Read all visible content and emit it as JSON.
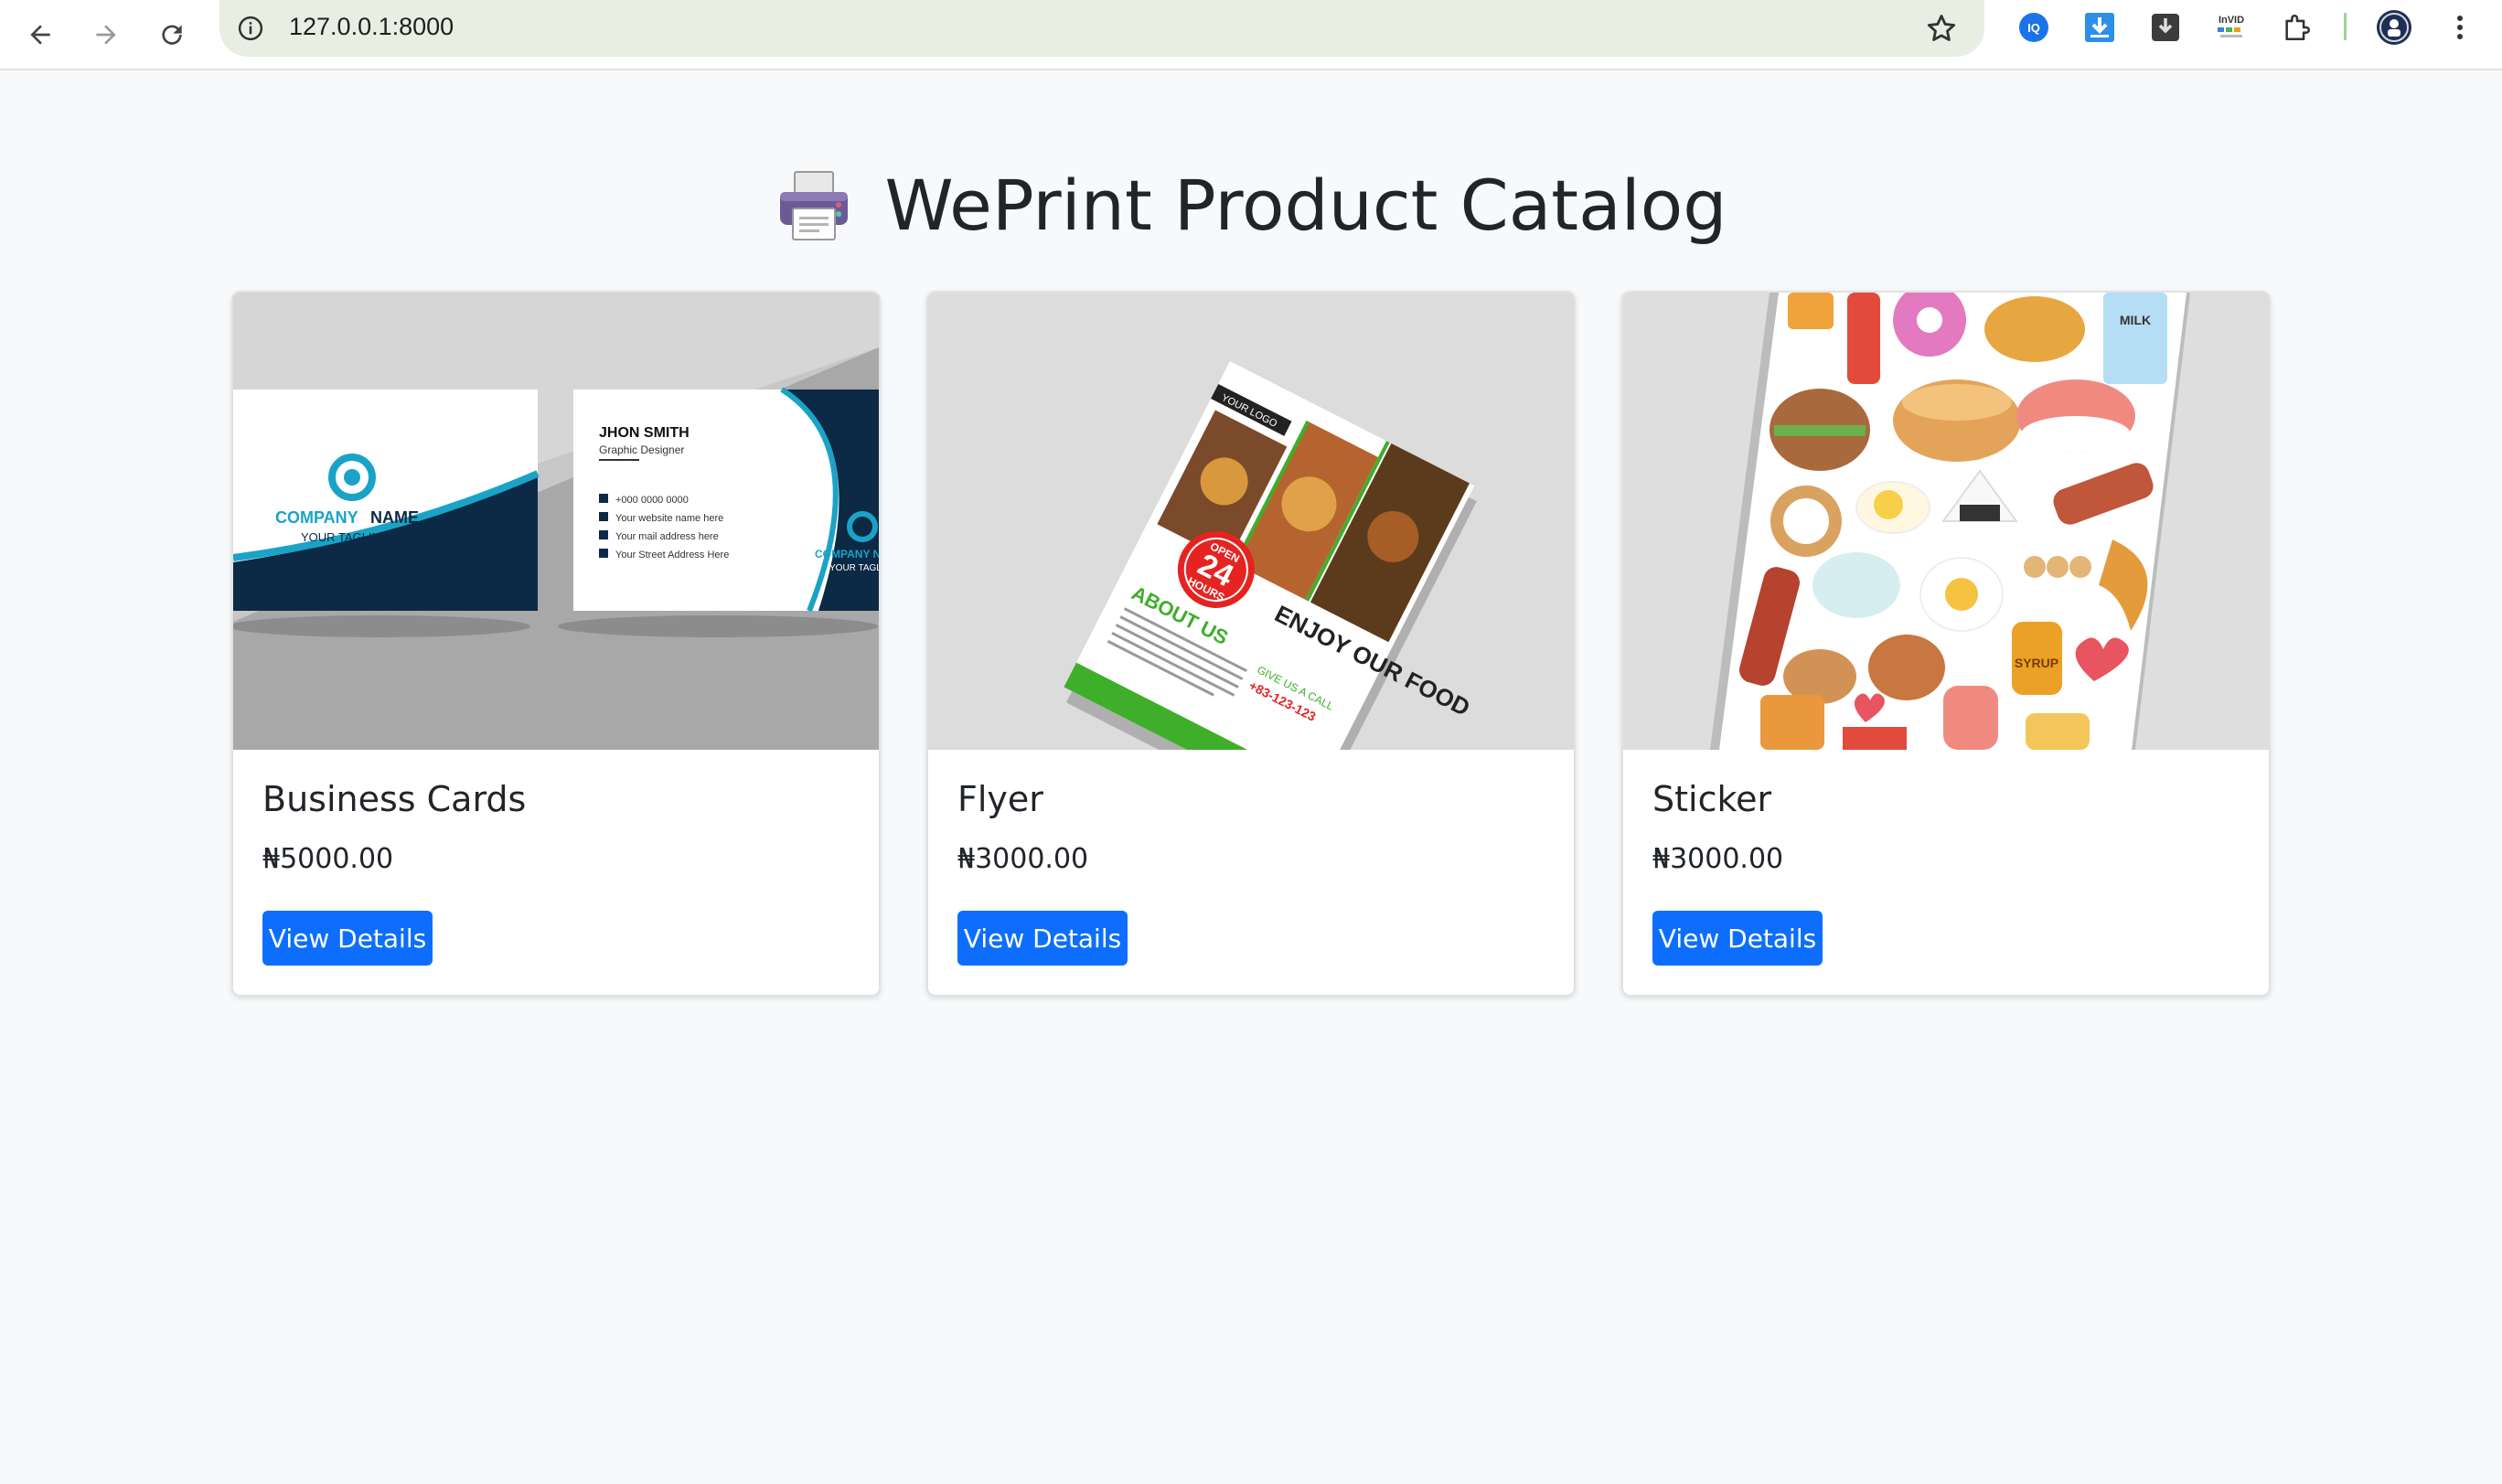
{
  "browser": {
    "url": "127.0.0.1:8000",
    "extensions": [
      "iq-extension-icon",
      "download-extension-icon",
      "download-box-extension-icon",
      "invid-extension-icon",
      "puzzle-extensions-icon"
    ],
    "invid_text": "InVID"
  },
  "page": {
    "title": "WePrint Product Catalog",
    "title_icon": "printer-icon"
  },
  "colors": {
    "primary": "#0d6efd",
    "background": "#f8f9fa",
    "text": "#212529"
  },
  "products": [
    {
      "name": "Business Cards",
      "price": "₦5000.00",
      "button": "View Details",
      "image": {
        "front_company": "COMPANY",
        "front_name": "NAME",
        "front_tagline": "YOUR TAGLINE",
        "back_name": "JHON SMITH",
        "back_role": "Graphic Designer",
        "back_phone": "+000 0000 0000",
        "back_web": "Your website name here",
        "back_mail": "Your mail address here",
        "back_address": "Your Street Address Here",
        "back_company": "COMPANY N",
        "back_tagline": "YOUR TAGL"
      }
    },
    {
      "name": "Flyer",
      "price": "₦3000.00",
      "button": "View Details",
      "image": {
        "logo": "YOUR LOGO",
        "badge_top": "OPEN",
        "badge_num": "24",
        "badge_bottom": "HOURS",
        "headline": "ENJOY OUR FOOD",
        "about": "ABOUT US",
        "cta": "GIVE US A CALL",
        "phone": "+83-123-123"
      }
    },
    {
      "name": "Sticker",
      "price": "₦3000.00",
      "button": "View Details",
      "image": {
        "milk": "MILK",
        "syrup": "SYRUP"
      }
    }
  ]
}
